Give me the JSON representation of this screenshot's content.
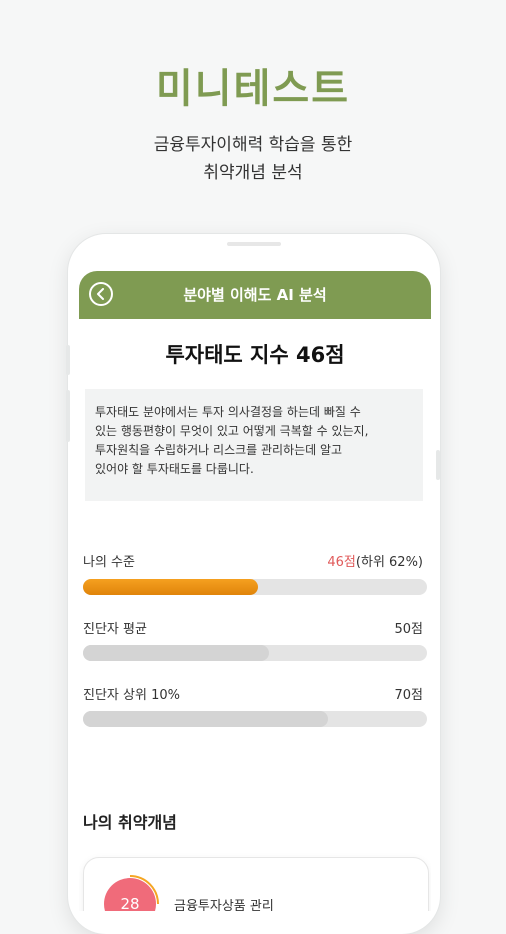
{
  "promo": {
    "title": "미니테스트",
    "subtitle_line1": "금융투자이해력 학습을 통한",
    "subtitle_line2": "취약개념 분석"
  },
  "appbar": {
    "title": "분야별 이해도 AI 분석",
    "back_icon": "chevron-left-icon"
  },
  "score": {
    "title": "투자태도 지수 46점",
    "description_lines": [
      "투자태도 분야에서는 투자 의사결정을 하는데 빠질 수",
      "있는 행동편향이 무엇이 있고 어떻게 극복할 수 있는지,",
      "투자원칙을 수립하거나 리스크를 관리하는데 알고",
      "있어야 할 투자태도를 다룹니다."
    ]
  },
  "levels": {
    "mine": {
      "label": "나의 수준",
      "score_text": "46점",
      "rank_text": "(하위 62%)",
      "score": 46
    },
    "average": {
      "label": "진단자 평균",
      "value_text": "50점",
      "score": 50
    },
    "top10": {
      "label": "진단자 상위 10%",
      "value_text": "70점",
      "score": 70
    },
    "max_score": 100
  },
  "weak_concepts": {
    "title": "나의 취약개념",
    "items": [
      {
        "badge": "28",
        "label": "금융투자상품 관리"
      }
    ]
  },
  "colors": {
    "accent": "#7f9b52",
    "bar_mine": "#f29a1c",
    "highlight": "#e05a5a",
    "badge": "#f06b7a"
  }
}
